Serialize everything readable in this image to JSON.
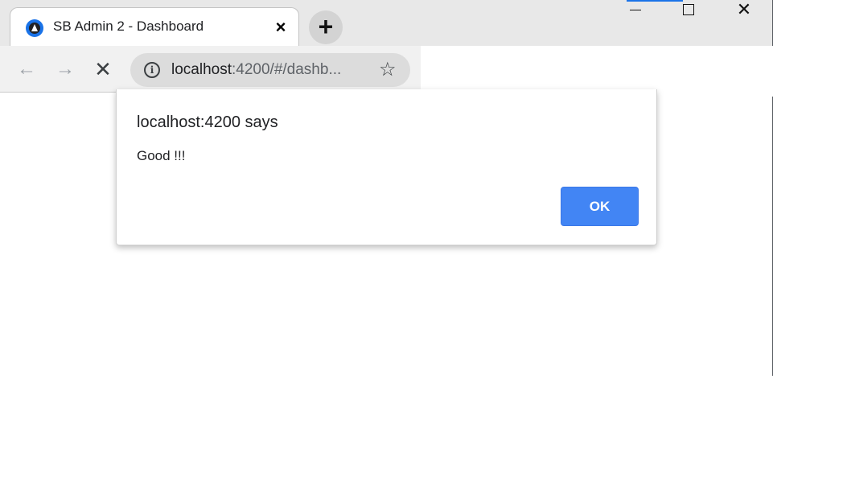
{
  "browser": {
    "tab": {
      "title": "SB Admin 2 - Dashboard",
      "close_icon": "×",
      "favicon": "angular-logo-icon"
    },
    "new_tab_icon": "+",
    "window_controls": {
      "close_icon": "✕"
    },
    "toolbar": {
      "back_icon": "←",
      "forward_icon": "→",
      "stop_icon": "✕",
      "info_icon": "i",
      "url_host": "localhost",
      "url_path": ":4200/#/dashb...",
      "star_icon": "☆"
    }
  },
  "dialog": {
    "title": "localhost:4200 says",
    "message": "Good !!!",
    "ok_label": "OK"
  },
  "colors": {
    "accent": "#1a73e8",
    "ok_button": "#4285f4"
  }
}
